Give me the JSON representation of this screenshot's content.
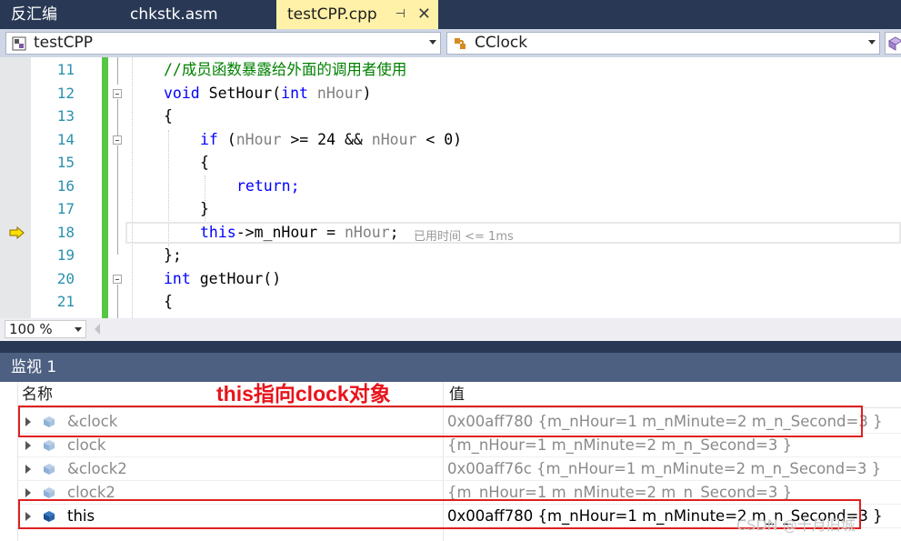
{
  "tabs": [
    {
      "label": "反汇编"
    },
    {
      "label": "chkstk.asm"
    },
    {
      "label": "testCPP.cpp",
      "active": true
    }
  ],
  "nav": {
    "project": "testCPP",
    "scope": "CClock"
  },
  "editor": {
    "lines": [
      {
        "num": "11",
        "code": "//成员函数暴露给外面的调用者使用"
      },
      {
        "num": "12",
        "code": "void SetHour(int nHour)"
      },
      {
        "num": "13",
        "code": "{"
      },
      {
        "num": "14",
        "code": "if (nHour >= 24 && nHour < 0)"
      },
      {
        "num": "15",
        "code": "{"
      },
      {
        "num": "16",
        "code": "return;"
      },
      {
        "num": "17",
        "code": "}"
      },
      {
        "num": "18",
        "code": "this->m_nHour = nHour;"
      },
      {
        "num": "19",
        "code": "};"
      },
      {
        "num": "20",
        "code": "int getHour()"
      },
      {
        "num": "21",
        "code": "{"
      }
    ],
    "perf_tip": "已用时间 <= 1ms",
    "zoom": "100 %"
  },
  "watch": {
    "title": "监视 1",
    "col_name": "名称",
    "col_value": "值",
    "rows": [
      {
        "name": "&clock",
        "value": "0x00aff780 {m_nHour=1 m_nMinute=2 m_n_Second=3 }"
      },
      {
        "name": "clock",
        "value": "{m_nHour=1 m_nMinute=2 m_n_Second=3 }"
      },
      {
        "name": "&clock2",
        "value": "0x00aff76c {m_nHour=1 m_nMinute=2 m_n_Second=3 }"
      },
      {
        "name": "clock2",
        "value": "{m_nHour=1 m_nMinute=2 m_n_Second=3 }"
      },
      {
        "name": "this",
        "value": "0x00aff780 {m_nHour=1 m_nMinute=2 m_n_Second=3 }"
      }
    ]
  },
  "annotation": "this指向clock对象",
  "watermark": "CSDN @十月旧城",
  "colors": {
    "accent_bg": "#293955",
    "tab_active": "#fff1a8",
    "change_bar": "#57c643",
    "annotation": "#e8141b"
  }
}
